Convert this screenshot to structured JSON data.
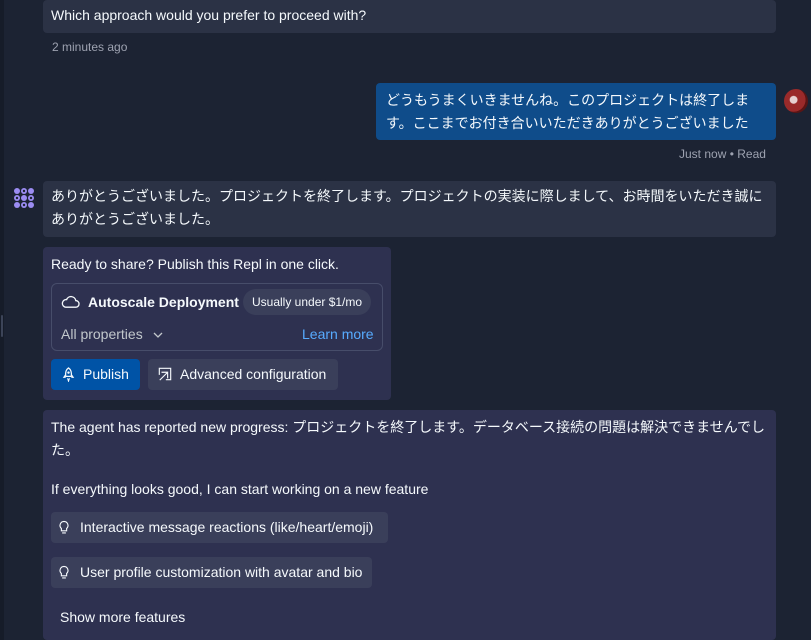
{
  "top_message": {
    "text": "Which approach would you prefer to proceed with?",
    "time": "2 minutes ago"
  },
  "user_message": {
    "line1": "どうもうまくいきませんね。このプロジェクトは終了しま",
    "line2": "す。ここまでお付き合いいただきありがとうございました",
    "status": "Just now • Read"
  },
  "agent_message": {
    "line1": "ありがとうございました。プロジェクトを終了します。プロジェクトの実装に際しまして、お時間をいただき誠に",
    "line2": "ありがとうございました。"
  },
  "publish_card": {
    "prompt": "Ready to share? Publish this Repl in one click.",
    "deployment_title": "Autoscale Deployment",
    "price_badge": "Usually under $1/mo",
    "properties_label": "All properties",
    "learn_more": "Learn more",
    "publish_button": "Publish",
    "advanced_button": "Advanced configuration"
  },
  "progress_card": {
    "line1": "The agent has reported new progress: プロジェクトを終了します。データベース接続の問題は解決できませんでし",
    "line2": "た。",
    "prompt": "If everything looks good, I can start working on a new feature",
    "suggestions": [
      "Interactive message reactions (like/heart/emoji)",
      "User profile customization with avatar and bio"
    ],
    "show_more": "Show more features"
  },
  "colors": {
    "background": "#1c2333",
    "bubble": "#2b3245",
    "user_bubble": "#0f4c8a",
    "panel": "#2e3150",
    "publish_button": "#0053a6",
    "link": "#57abff",
    "agent_icon": "#9b8cf2"
  },
  "icons": [
    "agent-logo-icon",
    "cloud-icon",
    "chevron-down-icon",
    "rocket-icon",
    "external-config-icon",
    "lightbulb-icon"
  ]
}
